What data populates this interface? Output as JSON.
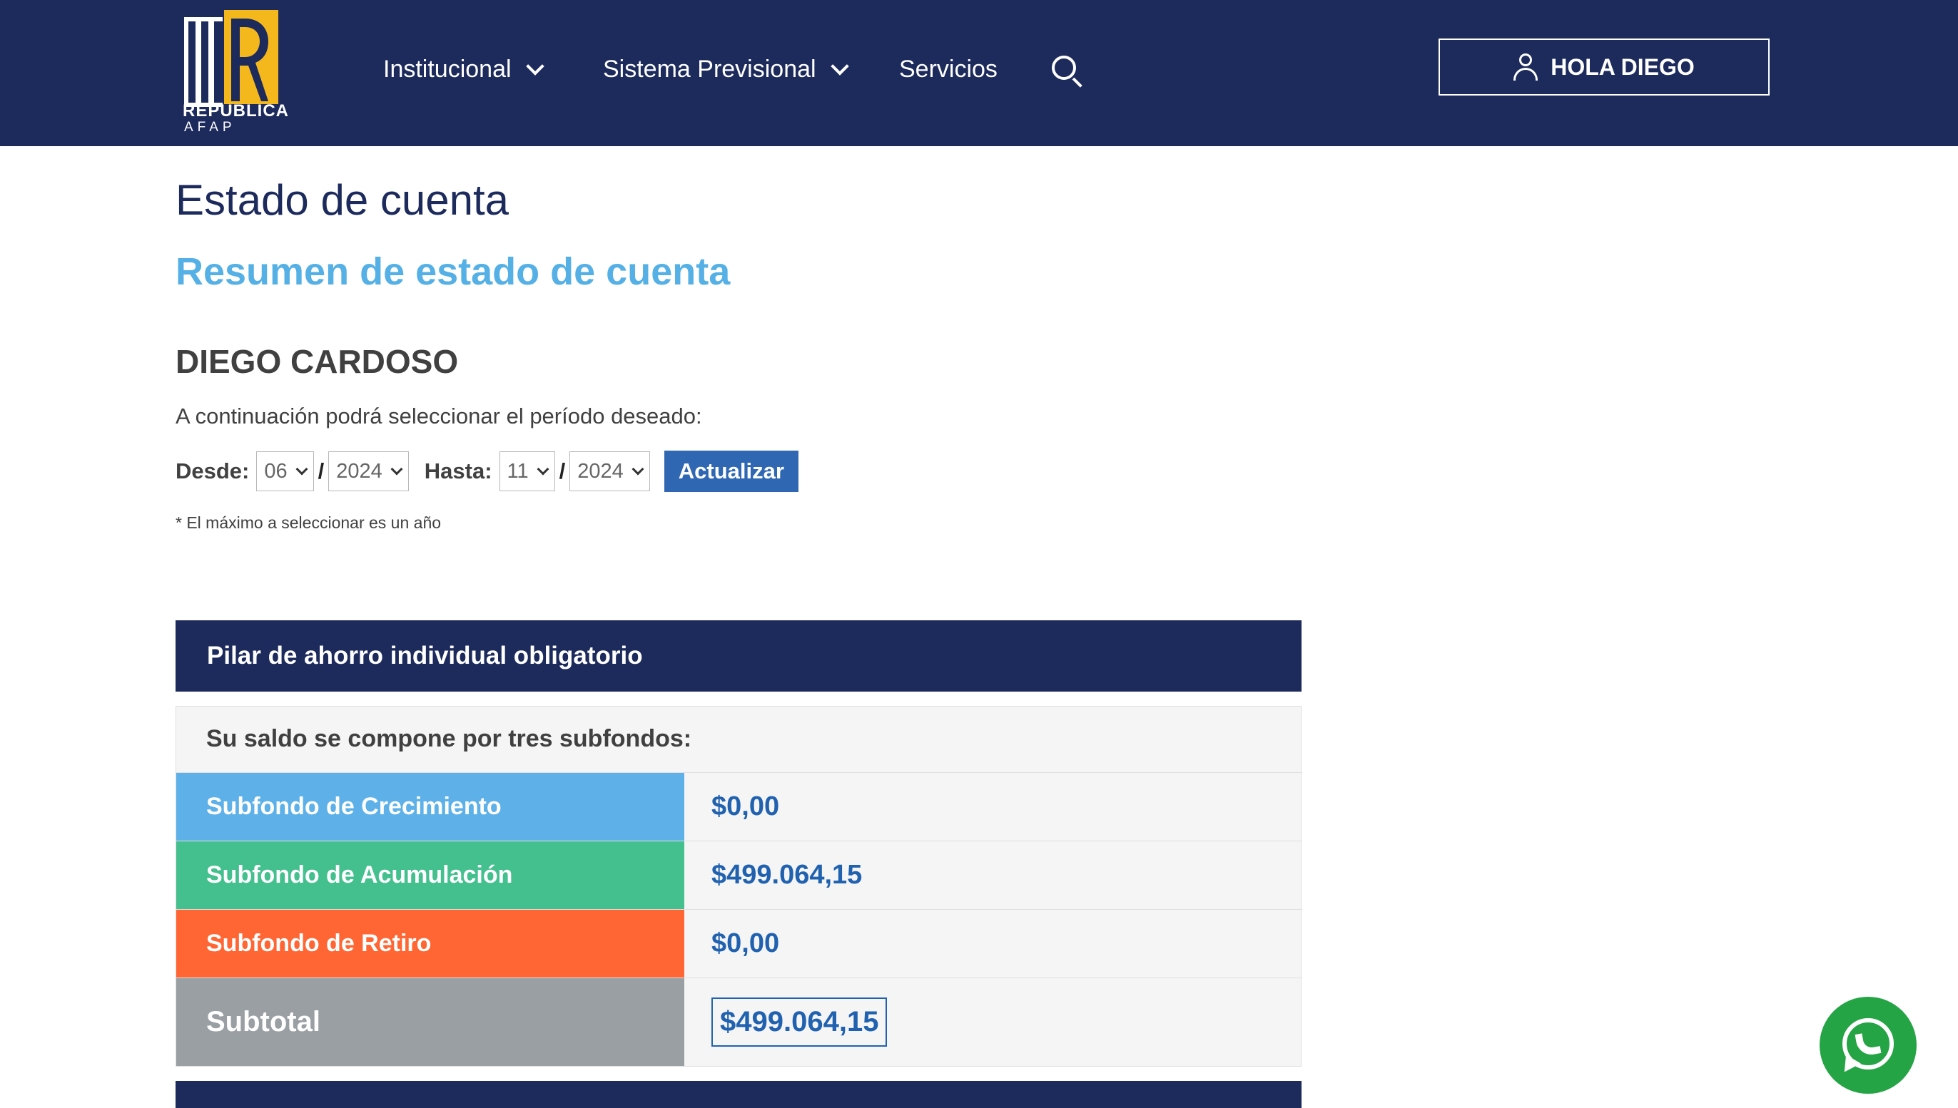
{
  "header": {
    "logo": {
      "name": "REPUBLICA",
      "sub": "AFAP",
      "colors": {
        "gold": "#f5b81c",
        "navy": "#1c2a5c"
      }
    },
    "nav": [
      {
        "label": "Institucional",
        "has_dropdown": true
      },
      {
        "label": "Sistema Previsional",
        "has_dropdown": true
      },
      {
        "label": "Servicios",
        "has_dropdown": false
      }
    ],
    "search_icon": "search-icon",
    "user_button": {
      "label": "HOLA DIEGO",
      "icon": "user-icon"
    }
  },
  "page": {
    "title": "Estado de cuenta",
    "subtitle": "Resumen de estado de cuenta",
    "user_name": "DIEGO CARDOSO",
    "intro": "A continuación podrá seleccionar el período deseado:"
  },
  "filter": {
    "from_label": "Desde:",
    "from_month": "06",
    "from_year": "2024",
    "to_label": "Hasta:",
    "to_month": "11",
    "to_year": "2024",
    "separator": "/",
    "update_button": "Actualizar",
    "note": "* El máximo a seleccionar es un año"
  },
  "pillar": {
    "title": "Pilar de ahorro individual obligatorio",
    "intro": "Su saldo se compone por tres subfondos:",
    "rows": [
      {
        "name": "Subfondo de Crecimiento",
        "value": "$0,00",
        "color": "#5db1e8"
      },
      {
        "name": "Subfondo de Acumulación",
        "value": "$499.064,15",
        "color": "#44c08f"
      },
      {
        "name": "Subfondo de Retiro",
        "value": "$0,00",
        "color": "#ff6633"
      }
    ],
    "subtotal": {
      "name": "Subtotal",
      "value": "$499.064,15",
      "color": "#999fa3"
    }
  },
  "floating": {
    "whatsapp_icon": "whatsapp-icon",
    "color": "#24a445"
  }
}
